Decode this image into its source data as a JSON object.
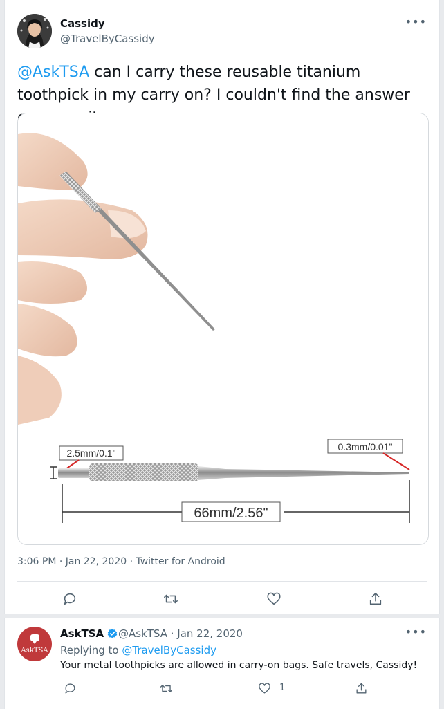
{
  "tweet": {
    "author_name": "Cassidy",
    "author_handle": "@TravelByCassidy",
    "more_label": "•••",
    "mention": "@AskTSA",
    "text": " can I carry these reusable titanium toothpick in my carry on? I couldn't find the answer on your site.",
    "image": {
      "label_head": "2.5mm/0.1\"",
      "label_tip": "0.3mm/0.01\"",
      "label_length": "66mm/2.56\""
    },
    "timestamp": "3:06 PM · Jan 22, 2020 · Twitter for Android"
  },
  "reply": {
    "author_name": "AskTSA",
    "author_handle": "@AskTSA · Jan 22, 2020",
    "avatar_text": "AskTSA",
    "replying_prefix": "Replying to ",
    "replying_to": "@TravelByCassidy",
    "text": "Your metal toothpicks are allowed in carry-on bags. Safe travels, Cassidy!",
    "like_count": "1",
    "more_label": "•••"
  },
  "icons": {
    "reply": "comment-icon",
    "retweet": "retweet-icon",
    "like": "heart-icon",
    "share": "share-icon",
    "verified": "verified-badge-icon"
  },
  "colors": {
    "link": "#1d9bf0",
    "muted": "#536471",
    "asktsa_red": "#c0393b"
  }
}
